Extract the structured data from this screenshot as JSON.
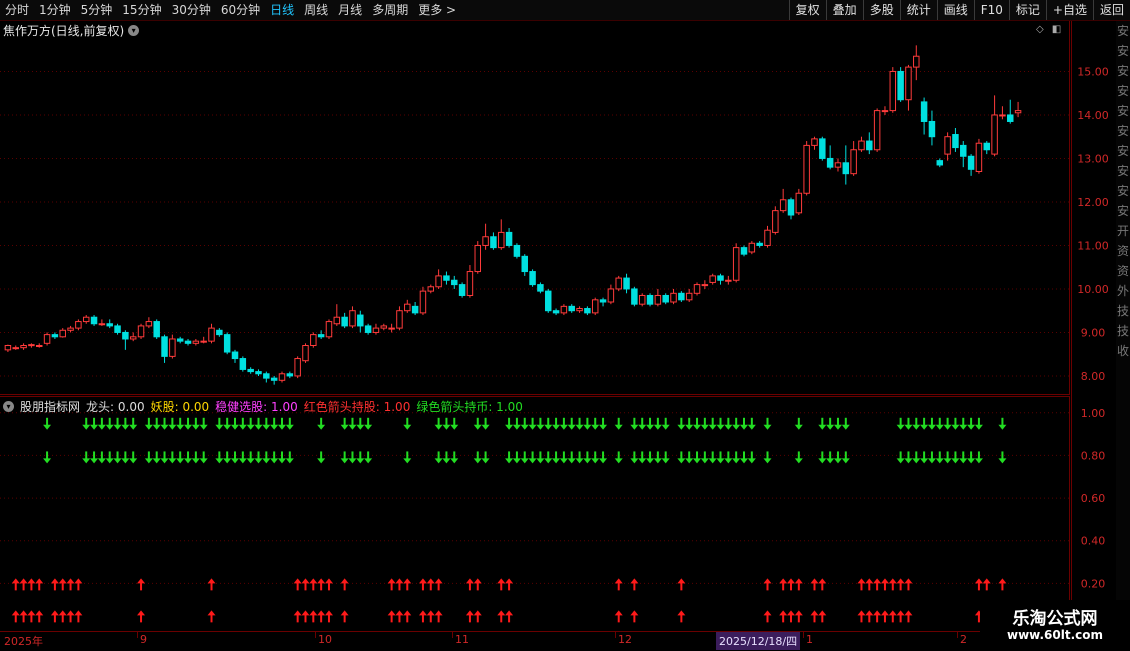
{
  "toolbar": {
    "periods": [
      {
        "label": "分时",
        "active": false
      },
      {
        "label": "1分钟",
        "active": false
      },
      {
        "label": "5分钟",
        "active": false
      },
      {
        "label": "15分钟",
        "active": false
      },
      {
        "label": "30分钟",
        "active": false
      },
      {
        "label": "60分钟",
        "active": false
      },
      {
        "label": "日线",
        "active": true
      },
      {
        "label": "周线",
        "active": false
      },
      {
        "label": "月线",
        "active": false
      },
      {
        "label": "多周期",
        "active": false
      },
      {
        "label": "更多 >",
        "active": false
      }
    ],
    "right_buttons": [
      "复权",
      "叠加",
      "多股",
      "统计",
      "画线",
      "F10",
      "标记",
      "+自选",
      "返回"
    ]
  },
  "main_panel": {
    "title": "焦作万方(日线,前复权)"
  },
  "indicator_panel": {
    "name": "股朋指标网",
    "items": [
      {
        "label": "龙头: 0.00",
        "color": "#dddddd"
      },
      {
        "label": "妖股: 0.00",
        "color": "#ffd700"
      },
      {
        "label": "稳健选股: 1.00",
        "color": "#ff40ff"
      },
      {
        "label": "红色箭头持股: 1.00",
        "color": "#ff3030"
      },
      {
        "label": "绿色箭头持币: 1.00",
        "color": "#22dd22"
      }
    ]
  },
  "axis": {
    "price_ticks": [
      "15.00",
      "14.00",
      "13.00",
      "12.00",
      "11.00",
      "10.00",
      "9.00",
      "8.00"
    ],
    "ind_ticks": [
      "1.00",
      "0.80",
      "0.60",
      "0.40",
      "0.20"
    ]
  },
  "date_bar": {
    "labels": [
      {
        "text": "2025年",
        "x": 4
      },
      {
        "text": "9",
        "x": 140
      },
      {
        "text": "10",
        "x": 318
      },
      {
        "text": "11",
        "x": 455
      },
      {
        "text": "12",
        "x": 618
      },
      {
        "text": "1",
        "x": 806
      },
      {
        "text": "2",
        "x": 960
      }
    ],
    "tooltip": "2025/12/18/四"
  },
  "side_strip": [
    "安",
    "安",
    "安",
    "安",
    "安",
    "安",
    "安",
    "安",
    "安",
    "安",
    "开",
    "资",
    "资",
    "外",
    "技",
    "技",
    "收"
  ],
  "watermark": {
    "title": "乐淘公式网",
    "url": "www.60lt.com"
  },
  "colors": {
    "up": "#ff3b3b",
    "down": "#00e0e0",
    "grid": "#5a0000",
    "green_arrow": "#22dd22",
    "red_arrow": "#ff1a1a"
  },
  "chart_data": {
    "type": "candlestick",
    "ylim": [
      7.7,
      15.7
    ],
    "candles": [
      [
        8.6,
        8.7,
        8.55,
        8.72
      ],
      [
        8.65,
        8.65,
        8.6,
        8.7
      ],
      [
        8.65,
        8.7,
        8.6,
        8.75
      ],
      [
        8.7,
        8.72,
        8.65,
        8.75
      ],
      [
        8.7,
        8.7,
        8.65,
        8.75
      ],
      [
        8.75,
        8.95,
        8.7,
        9.0
      ],
      [
        8.95,
        8.9,
        8.85,
        9.0
      ],
      [
        8.9,
        9.05,
        8.88,
        9.1
      ],
      [
        9.05,
        9.1,
        9.0,
        9.15
      ],
      [
        9.1,
        9.25,
        9.05,
        9.3
      ],
      [
        9.25,
        9.35,
        9.2,
        9.4
      ],
      [
        9.35,
        9.2,
        9.15,
        9.4
      ],
      [
        9.2,
        9.2,
        9.15,
        9.3
      ],
      [
        9.2,
        9.15,
        9.1,
        9.3
      ],
      [
        9.15,
        9.0,
        8.95,
        9.2
      ],
      [
        9.0,
        8.85,
        8.6,
        9.05
      ],
      [
        8.85,
        8.9,
        8.8,
        9.0
      ],
      [
        8.9,
        9.15,
        8.85,
        9.2
      ],
      [
        9.15,
        9.25,
        9.1,
        9.35
      ],
      [
        9.25,
        8.9,
        8.85,
        9.3
      ],
      [
        8.9,
        8.45,
        8.3,
        8.95
      ],
      [
        8.45,
        8.85,
        8.4,
        8.95
      ],
      [
        8.85,
        8.8,
        8.75,
        8.9
      ],
      [
        8.8,
        8.75,
        8.7,
        8.85
      ],
      [
        8.75,
        8.8,
        8.7,
        8.85
      ],
      [
        8.8,
        8.8,
        8.75,
        8.9
      ],
      [
        8.8,
        9.1,
        8.75,
        9.2
      ],
      [
        9.05,
        8.95,
        8.9,
        9.1
      ],
      [
        8.95,
        8.55,
        8.5,
        9.0
      ],
      [
        8.55,
        8.4,
        8.3,
        8.6
      ],
      [
        8.4,
        8.15,
        8.1,
        8.45
      ],
      [
        8.15,
        8.1,
        8.05,
        8.2
      ],
      [
        8.1,
        8.05,
        8.0,
        8.15
      ],
      [
        8.05,
        7.95,
        7.85,
        8.1
      ],
      [
        7.95,
        7.9,
        7.8,
        8.0
      ],
      [
        7.9,
        8.05,
        7.85,
        8.1
      ],
      [
        8.05,
        8.0,
        7.95,
        8.1
      ],
      [
        8.0,
        8.4,
        7.95,
        8.45
      ],
      [
        8.35,
        8.7,
        8.3,
        8.75
      ],
      [
        8.7,
        8.95,
        8.65,
        9.0
      ],
      [
        8.95,
        8.9,
        8.85,
        9.05
      ],
      [
        8.9,
        9.25,
        8.85,
        9.3
      ],
      [
        9.2,
        9.35,
        9.15,
        9.65
      ],
      [
        9.35,
        9.15,
        9.1,
        9.45
      ],
      [
        9.15,
        9.5,
        9.1,
        9.6
      ],
      [
        9.4,
        9.15,
        9.0,
        9.5
      ],
      [
        9.15,
        9.0,
        8.95,
        9.2
      ],
      [
        9.0,
        9.1,
        8.95,
        9.2
      ],
      [
        9.1,
        9.15,
        9.05,
        9.2
      ],
      [
        9.1,
        9.1,
        9.0,
        9.2
      ],
      [
        9.1,
        9.5,
        9.05,
        9.6
      ],
      [
        9.5,
        9.65,
        9.45,
        9.75
      ],
      [
        9.6,
        9.45,
        9.4,
        9.7
      ],
      [
        9.45,
        9.95,
        9.4,
        10.05
      ],
      [
        9.95,
        10.05,
        9.9,
        10.1
      ],
      [
        10.05,
        10.3,
        10.0,
        10.45
      ],
      [
        10.3,
        10.2,
        10.1,
        10.4
      ],
      [
        10.2,
        10.1,
        10.0,
        10.3
      ],
      [
        10.1,
        9.85,
        9.8,
        10.15
      ],
      [
        9.85,
        10.4,
        9.8,
        10.55
      ],
      [
        10.4,
        11.0,
        10.35,
        11.1
      ],
      [
        11.0,
        11.2,
        10.9,
        11.5
      ],
      [
        11.2,
        10.95,
        10.9,
        11.3
      ],
      [
        10.95,
        11.3,
        10.9,
        11.6
      ],
      [
        11.3,
        11.0,
        10.95,
        11.4
      ],
      [
        11.0,
        10.75,
        10.7,
        11.05
      ],
      [
        10.75,
        10.4,
        10.3,
        10.8
      ],
      [
        10.4,
        10.1,
        10.05,
        10.45
      ],
      [
        10.1,
        9.95,
        9.9,
        10.15
      ],
      [
        9.95,
        9.5,
        9.45,
        10.0
      ],
      [
        9.5,
        9.45,
        9.4,
        9.55
      ],
      [
        9.45,
        9.6,
        9.4,
        9.65
      ],
      [
        9.6,
        9.5,
        9.45,
        9.65
      ],
      [
        9.5,
        9.55,
        9.45,
        9.6
      ],
      [
        9.55,
        9.45,
        9.4,
        9.6
      ],
      [
        9.45,
        9.75,
        9.4,
        9.8
      ],
      [
        9.75,
        9.7,
        9.6,
        9.8
      ],
      [
        9.7,
        10.0,
        9.65,
        10.1
      ],
      [
        10.0,
        10.25,
        9.95,
        10.3
      ],
      [
        10.25,
        10.0,
        9.9,
        10.35
      ],
      [
        10.0,
        9.65,
        9.6,
        10.05
      ],
      [
        9.65,
        9.85,
        9.6,
        9.9
      ],
      [
        9.85,
        9.65,
        9.6,
        9.9
      ],
      [
        9.65,
        9.85,
        9.6,
        10.0
      ],
      [
        9.85,
        9.7,
        9.65,
        9.9
      ],
      [
        9.7,
        9.9,
        9.65,
        10.0
      ],
      [
        9.9,
        9.75,
        9.7,
        9.95
      ],
      [
        9.75,
        9.9,
        9.7,
        10.0
      ],
      [
        9.9,
        10.1,
        9.85,
        10.15
      ],
      [
        10.1,
        10.1,
        10.0,
        10.2
      ],
      [
        10.15,
        10.3,
        10.1,
        10.35
      ],
      [
        10.3,
        10.2,
        10.1,
        10.35
      ],
      [
        10.2,
        10.2,
        10.1,
        10.3
      ],
      [
        10.2,
        10.95,
        10.15,
        11.05
      ],
      [
        10.95,
        10.8,
        10.75,
        11.0
      ],
      [
        10.85,
        11.05,
        10.8,
        11.1
      ],
      [
        11.05,
        11.0,
        10.95,
        11.1
      ],
      [
        11.0,
        11.35,
        10.95,
        11.45
      ],
      [
        11.3,
        11.8,
        11.25,
        11.9
      ],
      [
        11.8,
        12.05,
        11.75,
        12.3
      ],
      [
        12.05,
        11.7,
        11.6,
        12.1
      ],
      [
        11.75,
        12.2,
        11.7,
        12.3
      ],
      [
        12.2,
        13.3,
        12.15,
        13.4
      ],
      [
        13.3,
        13.45,
        13.2,
        13.5
      ],
      [
        13.45,
        13.0,
        12.95,
        13.5
      ],
      [
        13.0,
        12.8,
        12.75,
        13.3
      ],
      [
        12.8,
        12.9,
        12.7,
        13.0
      ],
      [
        12.9,
        12.65,
        12.4,
        13.3
      ],
      [
        12.65,
        13.2,
        12.6,
        13.4
      ],
      [
        13.2,
        13.4,
        13.15,
        13.5
      ],
      [
        13.4,
        13.2,
        13.1,
        13.6
      ],
      [
        13.2,
        14.1,
        13.15,
        14.15
      ],
      [
        14.1,
        14.1,
        14.0,
        14.2
      ],
      [
        14.1,
        15.0,
        14.05,
        15.1
      ],
      [
        15.0,
        14.35,
        14.3,
        15.1
      ],
      [
        14.35,
        15.1,
        14.1,
        15.15
      ],
      [
        15.1,
        15.35,
        14.8,
        15.6
      ],
      [
        14.3,
        13.85,
        13.55,
        14.4
      ],
      [
        13.85,
        13.5,
        13.3,
        14.1
      ],
      [
        12.95,
        12.85,
        12.8,
        13.0
      ],
      [
        13.1,
        13.5,
        12.95,
        13.6
      ],
      [
        13.55,
        13.25,
        13.15,
        13.7
      ],
      [
        13.3,
        13.05,
        12.8,
        13.4
      ],
      [
        13.05,
        12.75,
        12.6,
        13.1
      ],
      [
        12.7,
        13.35,
        12.65,
        13.45
      ],
      [
        13.35,
        13.2,
        13.1,
        13.4
      ],
      [
        13.1,
        14.0,
        13.05,
        14.45
      ],
      [
        14.0,
        14.0,
        13.9,
        14.2
      ],
      [
        14.0,
        13.85,
        13.8,
        14.35
      ],
      [
        14.05,
        14.1,
        13.95,
        14.3
      ]
    ],
    "indicator_ylim": [
      0.0,
      1.06
    ],
    "indicator_ticks": [
      1.0,
      0.8,
      0.6,
      0.4,
      0.2
    ],
    "green_arrow_days": [
      5,
      10,
      11,
      12,
      13,
      14,
      15,
      16,
      18,
      19,
      20,
      21,
      22,
      23,
      24,
      25,
      27,
      28,
      29,
      30,
      31,
      32,
      33,
      34,
      35,
      36,
      40,
      43,
      44,
      45,
      46,
      51,
      55,
      56,
      57,
      60,
      61,
      64,
      65,
      66,
      67,
      68,
      69,
      70,
      71,
      72,
      73,
      74,
      75,
      76,
      78,
      80,
      81,
      82,
      83,
      84,
      86,
      87,
      88,
      89,
      90,
      91,
      92,
      93,
      94,
      95,
      97,
      101,
      104,
      105,
      106,
      107,
      114,
      115,
      116,
      117,
      118,
      119,
      120,
      121,
      122,
      123,
      124,
      127
    ],
    "red_arrow_days": [
      1,
      2,
      3,
      4,
      6,
      7,
      8,
      9,
      17,
      26,
      37,
      38,
      39,
      40,
      41,
      43,
      49,
      50,
      51,
      53,
      54,
      55,
      59,
      60,
      63,
      64,
      78,
      80,
      86,
      97,
      99,
      100,
      101,
      103,
      104,
      109,
      110,
      111,
      112,
      113,
      114,
      115,
      124,
      125,
      127
    ]
  }
}
